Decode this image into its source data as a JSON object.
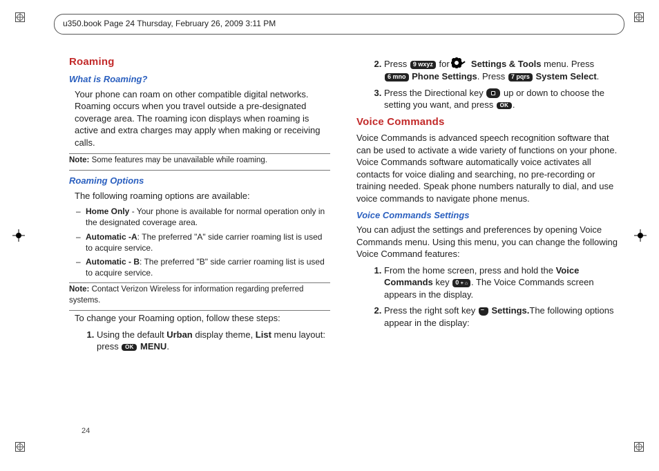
{
  "header": {
    "stamp": "u350.book  Page 24  Thursday, February 26, 2009  3:11 PM"
  },
  "left": {
    "h_roaming": "Roaming",
    "h_what": "What is Roaming?",
    "p_what": "Your phone can roam on other compatible digital networks. Roaming occurs when you travel outside a pre-designated coverage area. The roaming icon displays when roaming is active and extra charges may apply when making or receiving calls.",
    "note1_label": "Note:",
    "note1": " Some features may be unavailable while roaming.",
    "h_options": "Roaming Options",
    "p_options_intro": "The following roaming options are available:",
    "opt1_b": "Home Only",
    "opt1_rest": " - Your phone is available for normal operation only in the designated coverage area.",
    "opt2_b": "Automatic -A",
    "opt2_rest": ": The preferred \"A\" side carrier roaming list is used to acquire service.",
    "opt3_b": "Automatic - B",
    "opt3_rest": ": The preferred \"B\" side carrier roaming list is used to acquire service.",
    "note2_label": "Note:",
    "note2": " Contact Verizon Wireless for information regarding preferred systems.",
    "p_change": "To change your Roaming option, follow these steps:",
    "step1_a": "Using the default ",
    "step1_b1": "Urban",
    "step1_mid": " display theme, ",
    "step1_b2": "List",
    "step1_c": " menu layout: press ",
    "step1_menu": "MENU",
    "step1_end": "."
  },
  "right": {
    "s2_a": "Press ",
    "s2_for": " for ",
    "s2_st": "Settings & Tools",
    "s2_menu": " menu. Press ",
    "s2_ps": "Phone Settings",
    "s2_press": ". Press ",
    "s2_ss": "System Select",
    "s2_end": ".",
    "s3_a": "Press the Directional key ",
    "s3_b": " up or down to choose the setting you want, and press ",
    "s3_end": ".",
    "h_vc": "Voice Commands",
    "p_vc": "Voice Commands is advanced speech recognition software that can be used to activate a wide variety of functions on your phone. Voice Commands software automatically voice activates all contacts for voice dialing and searching, no pre-recording or training needed. Speak phone numbers naturally to dial, and use voice commands to navigate phone menus.",
    "h_vcs": "Voice Commands Settings",
    "p_vcs": "You can adjust the settings and preferences by opening Voice Commands menu. Using this menu, you can change the following Voice Command features:",
    "vcs1_a": "From the home screen, press and hold the ",
    "vcs1_b": "Voice Commands",
    "vcs1_c": " key ",
    "vcs1_d": ". The Voice Commands screen appears in the display.",
    "vcs2_a": "Press the right soft key ",
    "vcs2_b": "Settings.",
    "vcs2_c": "The following options appear in the display:"
  },
  "keys": {
    "ok": "OK",
    "nine": "9 wxyz",
    "six": "6 mno",
    "seven": "7 pqrs",
    "zero": "0 ",
    "zero_suffix": "+ ⌂"
  },
  "footer": {
    "pagenum": "24"
  }
}
